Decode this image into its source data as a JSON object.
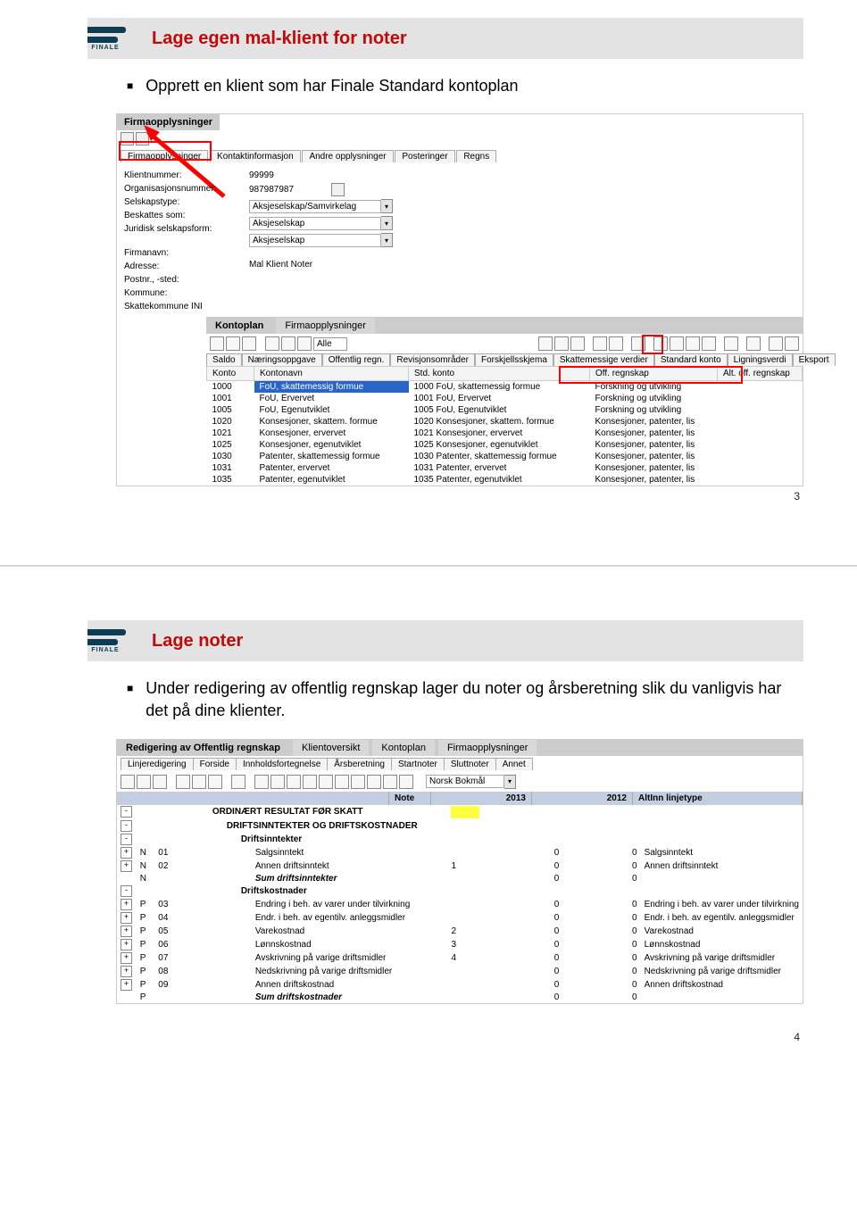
{
  "slide1": {
    "title": "Lage egen mal-klient for noter",
    "bullet": "Opprett en klient som har Finale Standard kontoplan",
    "page_number": "3",
    "logo_label": "FINALE",
    "firma_block": {
      "header_tab": "Firmaopplysninger",
      "tabs": [
        "Firmaopplysninger",
        "Kontaktinformasjon",
        "Andre opplysninger",
        "Posteringer",
        "Regns"
      ],
      "labels": {
        "klient": "Klientnummer:",
        "orgnr": "Organisasjonsnummer:",
        "selskapstype": "Selskapstype:",
        "beskattes": "Beskattes som:",
        "juridisk": "Juridisk selskapsform:",
        "firmanavn": "Firmanavn:",
        "adresse": "Adresse:",
        "postnr": "Postnr., -sted:",
        "kommune": "Kommune:",
        "skattekommune": "Skattekommune INI"
      },
      "values": {
        "klient": "99999",
        "orgnr": "987987987",
        "selskapstype": "Aksjeselskap/Samvirkelag",
        "beskattes": "Aksjeselskap",
        "juridisk": "Aksjeselskap",
        "firmanavn": "Mal Klient Noter"
      }
    },
    "konto_block": {
      "main_tab": "Kontoplan",
      "inactive_tab": "Firmaopplysninger",
      "filter": "Alle",
      "sec_tabs": [
        "Saldo",
        "Næringsoppgave",
        "Offentlig regn.",
        "Revisjonsområder",
        "Forskjellsskjema",
        "Skattemessige verdier",
        "Standard konto",
        "Ligningsverdi",
        "Eksport"
      ],
      "columns": [
        "Konto",
        "Kontonavn",
        "Std. konto",
        "Off. regnskap",
        "Alt. off. regnskap"
      ],
      "rows": [
        {
          "k": "1000",
          "n": "FoU, skattemessig formue",
          "s": "1000 FoU, skattemessig formue",
          "o": "Forskning og utvikling"
        },
        {
          "k": "1001",
          "n": "FoU, Ervervet",
          "s": "1001 FoU, Ervervet",
          "o": "Forskning og utvikling"
        },
        {
          "k": "1005",
          "n": "FoU, Egenutviklet",
          "s": "1005 FoU, Egenutviklet",
          "o": "Forskning og utvikling"
        },
        {
          "k": "1020",
          "n": "Konsesjoner, skattem. formue",
          "s": "1020 Konsesjoner, skattem. formue",
          "o": "Konsesjoner, patenter, lis"
        },
        {
          "k": "1021",
          "n": "Konsesjoner, ervervet",
          "s": "1021 Konsesjoner, ervervet",
          "o": "Konsesjoner, patenter, lis"
        },
        {
          "k": "1025",
          "n": "Konsesjoner, egenutviklet",
          "s": "1025 Konsesjoner, egenutviklet",
          "o": "Konsesjoner, patenter, lis"
        },
        {
          "k": "1030",
          "n": "Patenter, skattemessig formue",
          "s": "1030 Patenter, skattemessig formue",
          "o": "Konsesjoner, patenter, lis"
        },
        {
          "k": "1031",
          "n": "Patenter, ervervet",
          "s": "1031 Patenter, ervervet",
          "o": "Konsesjoner, patenter, lis"
        },
        {
          "k": "1035",
          "n": "Patenter, egenutviklet",
          "s": "1035 Patenter, egenutviklet",
          "o": "Konsesjoner, patenter, lis"
        }
      ]
    }
  },
  "slide2": {
    "title": "Lage noter",
    "bullet": "Under redigering av offentlig regnskap lager du noter og årsberetning slik du vanligvis har det på dine klienter.",
    "page_number": "4",
    "logo_label": "FINALE",
    "edit_block": {
      "main_tab": "Redigering av Offentlig regnskap",
      "inactive_tabs": [
        "Klientoversikt",
        "Kontoplan",
        "Firmaopplysninger"
      ],
      "tabs": [
        "Linjeredigering",
        "Forside",
        "Innholdsfortegnelse",
        "Årsberetning",
        "Startnoter",
        "Sluttnoter",
        "Annet"
      ],
      "language": "Norsk Bokmål",
      "columns": [
        "Note",
        "2013",
        "2012",
        "AltInn linjetype"
      ],
      "lines": [
        {
          "exp": "-",
          "np": "",
          "nr": "",
          "text": "ORDINÆRT RESULTAT FØR SKATT",
          "cls": "indent0",
          "note": "",
          "y13": "",
          "y12": "",
          "alt": ""
        },
        {
          "exp": "-",
          "np": "",
          "nr": "",
          "text": "DRIFTSINNTEKTER OG DRIFTSKOSTNADER",
          "cls": "indent1",
          "note": "",
          "y13": "",
          "y12": "",
          "alt": ""
        },
        {
          "exp": "-",
          "np": "",
          "nr": "",
          "text": "Driftsinntekter",
          "cls": "indent2",
          "note": "",
          "y13": "",
          "y12": "",
          "alt": ""
        },
        {
          "exp": "+",
          "np": "N",
          "nr": "01",
          "text": "Salgsinntekt",
          "cls": "indent3",
          "note": "",
          "y13": "0",
          "y12": "0",
          "alt": "Salgsinntekt"
        },
        {
          "exp": "+",
          "np": "N",
          "nr": "02",
          "text": "Annen driftsinntekt",
          "cls": "indent3",
          "note": "1",
          "y13": "0",
          "y12": "0",
          "alt": "Annen driftsinntekt"
        },
        {
          "exp": "",
          "np": "N",
          "nr": "",
          "text": "Sum driftsinntekter",
          "cls": "indent3 sum",
          "note": "",
          "y13": "0",
          "y12": "0",
          "alt": ""
        },
        {
          "exp": "-",
          "np": "",
          "nr": "",
          "text": "Driftskostnader",
          "cls": "indent2",
          "note": "",
          "y13": "",
          "y12": "",
          "alt": ""
        },
        {
          "exp": "+",
          "np": "P",
          "nr": "03",
          "text": "Endring i beh. av varer under tilvirkning",
          "cls": "indent3",
          "note": "",
          "y13": "0",
          "y12": "0",
          "alt": "Endring i beh. av varer under tilvirkning"
        },
        {
          "exp": "+",
          "np": "P",
          "nr": "04",
          "text": "Endr. i beh. av egentilv. anleggsmidler",
          "cls": "indent3",
          "note": "",
          "y13": "0",
          "y12": "0",
          "alt": "Endr. i beh. av egentilv. anleggsmidler"
        },
        {
          "exp": "+",
          "np": "P",
          "nr": "05",
          "text": "Varekostnad",
          "cls": "indent3",
          "note": "2",
          "y13": "0",
          "y12": "0",
          "alt": "Varekostnad"
        },
        {
          "exp": "+",
          "np": "P",
          "nr": "06",
          "text": "Lønnskostnad",
          "cls": "indent3",
          "note": "3",
          "y13": "0",
          "y12": "0",
          "alt": "Lønnskostnad"
        },
        {
          "exp": "+",
          "np": "P",
          "nr": "07",
          "text": "Avskrivning på varige driftsmidler",
          "cls": "indent3",
          "note": "4",
          "y13": "0",
          "y12": "0",
          "alt": "Avskrivning på varige driftsmidler"
        },
        {
          "exp": "+",
          "np": "P",
          "nr": "08",
          "text": "Nedskrivning på varige driftsmidler",
          "cls": "indent3",
          "note": "",
          "y13": "0",
          "y12": "0",
          "alt": "Nedskrivning på varige driftsmidler"
        },
        {
          "exp": "+",
          "np": "P",
          "nr": "09",
          "text": "Annen driftskostnad",
          "cls": "indent3",
          "note": "",
          "y13": "0",
          "y12": "0",
          "alt": "Annen driftskostnad"
        },
        {
          "exp": "",
          "np": "P",
          "nr": "",
          "text": "Sum driftskostnader",
          "cls": "indent3 sum",
          "note": "",
          "y13": "0",
          "y12": "0",
          "alt": ""
        }
      ]
    }
  }
}
